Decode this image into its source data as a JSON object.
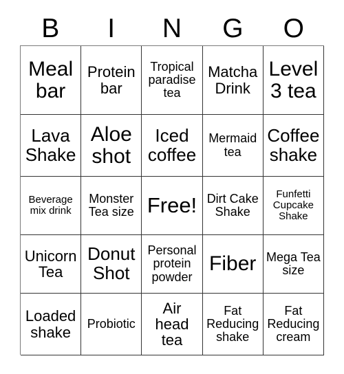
{
  "card": {
    "title": "BINGO",
    "header_letters": [
      "B",
      "I",
      "N",
      "G",
      "O"
    ],
    "free_space": "Free!",
    "grid_rows": 5,
    "grid_cols": 5,
    "colors": {
      "background": "#ffffff",
      "text": "#000000",
      "grid_line": "#333333",
      "outer_line": "#7a7a7a"
    }
  },
  "cells": [
    {
      "text": "Meal bar",
      "size": "fs-xl"
    },
    {
      "text": "Protein bar",
      "size": "fs-md"
    },
    {
      "text": "Tropical paradise tea",
      "size": "fs-sm"
    },
    {
      "text": "Matcha Drink",
      "size": "fs-md"
    },
    {
      "text": "Level 3 tea",
      "size": "fs-xl"
    },
    {
      "text": "Lava Shake",
      "size": "fs-lg"
    },
    {
      "text": "Aloe shot",
      "size": "fs-xl"
    },
    {
      "text": "Iced coffee",
      "size": "fs-lg"
    },
    {
      "text": "Mermaid tea",
      "size": "fs-sm"
    },
    {
      "text": "Coffee shake",
      "size": "fs-lg"
    },
    {
      "text": "Beverage mix drink",
      "size": "fs-xs"
    },
    {
      "text": "Monster Tea size",
      "size": "fs-sm"
    },
    {
      "text": "Free!",
      "size": "fs-free"
    },
    {
      "text": "Dirt Cake Shake",
      "size": "fs-sm"
    },
    {
      "text": "Funfetti Cupcake Shake",
      "size": "fs-xs"
    },
    {
      "text": "Unicorn Tea",
      "size": "fs-md"
    },
    {
      "text": "Donut Shot",
      "size": "fs-lg"
    },
    {
      "text": "Personal protein powder",
      "size": "fs-sm"
    },
    {
      "text": "Fiber",
      "size": "fs-xl"
    },
    {
      "text": "Mega Tea size",
      "size": "fs-sm"
    },
    {
      "text": "Loaded shake",
      "size": "fs-md"
    },
    {
      "text": "Probiotic",
      "size": "fs-sm"
    },
    {
      "text": "Air head tea",
      "size": "fs-md"
    },
    {
      "text": "Fat Reducing shake",
      "size": "fs-sm"
    },
    {
      "text": "Fat Reducing cream",
      "size": "fs-sm"
    }
  ]
}
